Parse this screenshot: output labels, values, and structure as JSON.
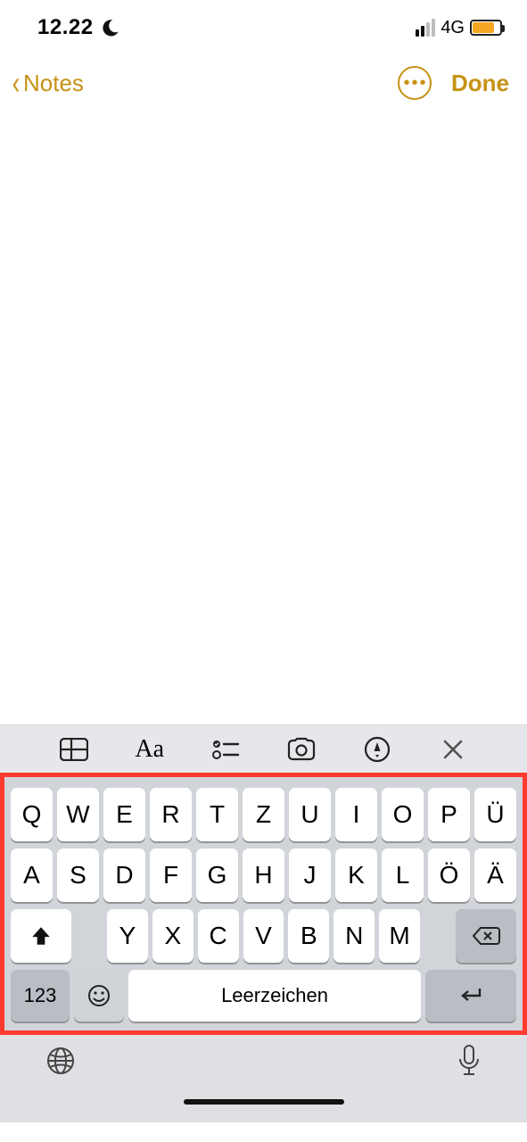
{
  "status": {
    "time": "12.22",
    "network": "4G"
  },
  "nav": {
    "back_label": "Notes",
    "done_label": "Done"
  },
  "format_bar": {
    "text_style_label": "Aa"
  },
  "keyboard": {
    "row1": [
      "Q",
      "W",
      "E",
      "R",
      "T",
      "Z",
      "U",
      "I",
      "O",
      "P",
      "Ü"
    ],
    "row2": [
      "A",
      "S",
      "D",
      "F",
      "G",
      "H",
      "J",
      "K",
      "L",
      "Ö",
      "Ä"
    ],
    "row3": [
      "Y",
      "X",
      "C",
      "V",
      "B",
      "N",
      "M"
    ],
    "numbers_label": "123",
    "space_label": "Leerzeichen"
  }
}
